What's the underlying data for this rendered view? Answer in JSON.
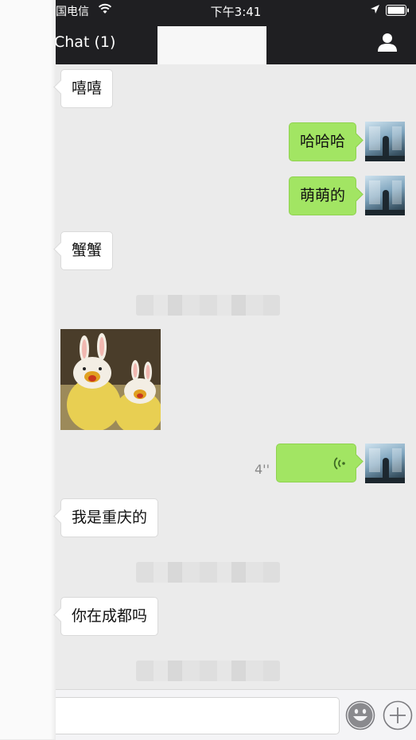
{
  "status": {
    "carrier": "国电信",
    "time": "下午3:41"
  },
  "nav": {
    "title": "Chat (1)"
  },
  "messages": [
    {
      "side": "left",
      "type": "text",
      "text": "嘻嘻"
    },
    {
      "side": "right",
      "type": "text",
      "text": "哈哈哈"
    },
    {
      "side": "right",
      "type": "text",
      "text": "萌萌的"
    },
    {
      "side": "left",
      "type": "text",
      "text": "蟹蟹"
    },
    {
      "side": "center",
      "type": "blurred-notice"
    },
    {
      "side": "left",
      "type": "sticker",
      "icon": "bunny-sticker-image"
    },
    {
      "side": "right",
      "type": "voice",
      "duration": "4''"
    },
    {
      "side": "left",
      "type": "text",
      "text": "我是重庆的"
    },
    {
      "side": "center",
      "type": "blurred-notice"
    },
    {
      "side": "left",
      "type": "text",
      "text": "你在成都吗"
    },
    {
      "side": "center",
      "type": "blurred-notice"
    }
  ],
  "input": {
    "value": "",
    "emoji_icon": "smiley-icon",
    "plus_icon": "plus-circle-icon"
  },
  "colors": {
    "nav_bg": "#1f1f22",
    "chat_bg": "#ebebeb",
    "sent_bubble": "#a2e563",
    "received_bubble": "#ffffff"
  }
}
